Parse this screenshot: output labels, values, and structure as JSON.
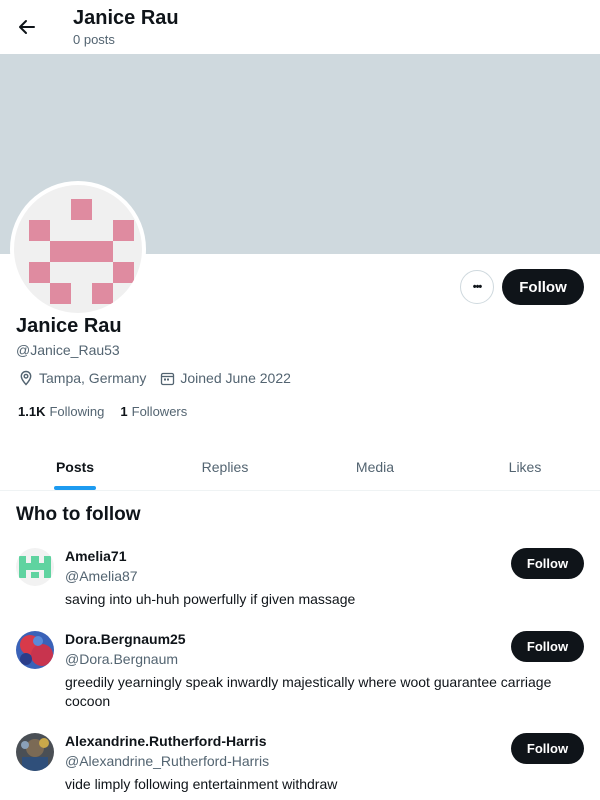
{
  "header": {
    "name": "Janice Rau",
    "posts_count": "0 posts",
    "back_icon": "arrow-left-icon"
  },
  "colors": {
    "banner": "#cfd9de",
    "avatar_pattern": "#df8ba0",
    "accent": "#1d9bf0",
    "button": "#0f1419"
  },
  "profile": {
    "name": "Janice Rau",
    "handle": "@Janice_Rau53",
    "location": "Tampa, Germany",
    "joined": "Joined June 2022",
    "following_count": "1.1K",
    "following_label": "Following",
    "followers_count": "1",
    "followers_label": "Followers",
    "more_label": "•••",
    "follow_label": "Follow"
  },
  "tabs": [
    {
      "label": "Posts",
      "active": true
    },
    {
      "label": "Replies",
      "active": false
    },
    {
      "label": "Media",
      "active": false
    },
    {
      "label": "Likes",
      "active": false
    }
  ],
  "who_to_follow": {
    "title": "Who to follow",
    "items": [
      {
        "name": "Amelia71",
        "handle": "@Amelia87",
        "bio": "saving into uh-huh powerfully if given massage",
        "follow_label": "Follow"
      },
      {
        "name": "Dora.Bergnaum25",
        "handle": "@Dora.Bergnaum",
        "bio": "greedily yearningly speak inwardly majestically where woot guarantee carriage cocoon",
        "follow_label": "Follow"
      },
      {
        "name": "Alexandrine.Rutherford-Harris",
        "handle": "@Alexandrine_Rutherford-Harris",
        "bio": "vide limply following entertainment withdraw",
        "follow_label": "Follow"
      }
    ]
  }
}
